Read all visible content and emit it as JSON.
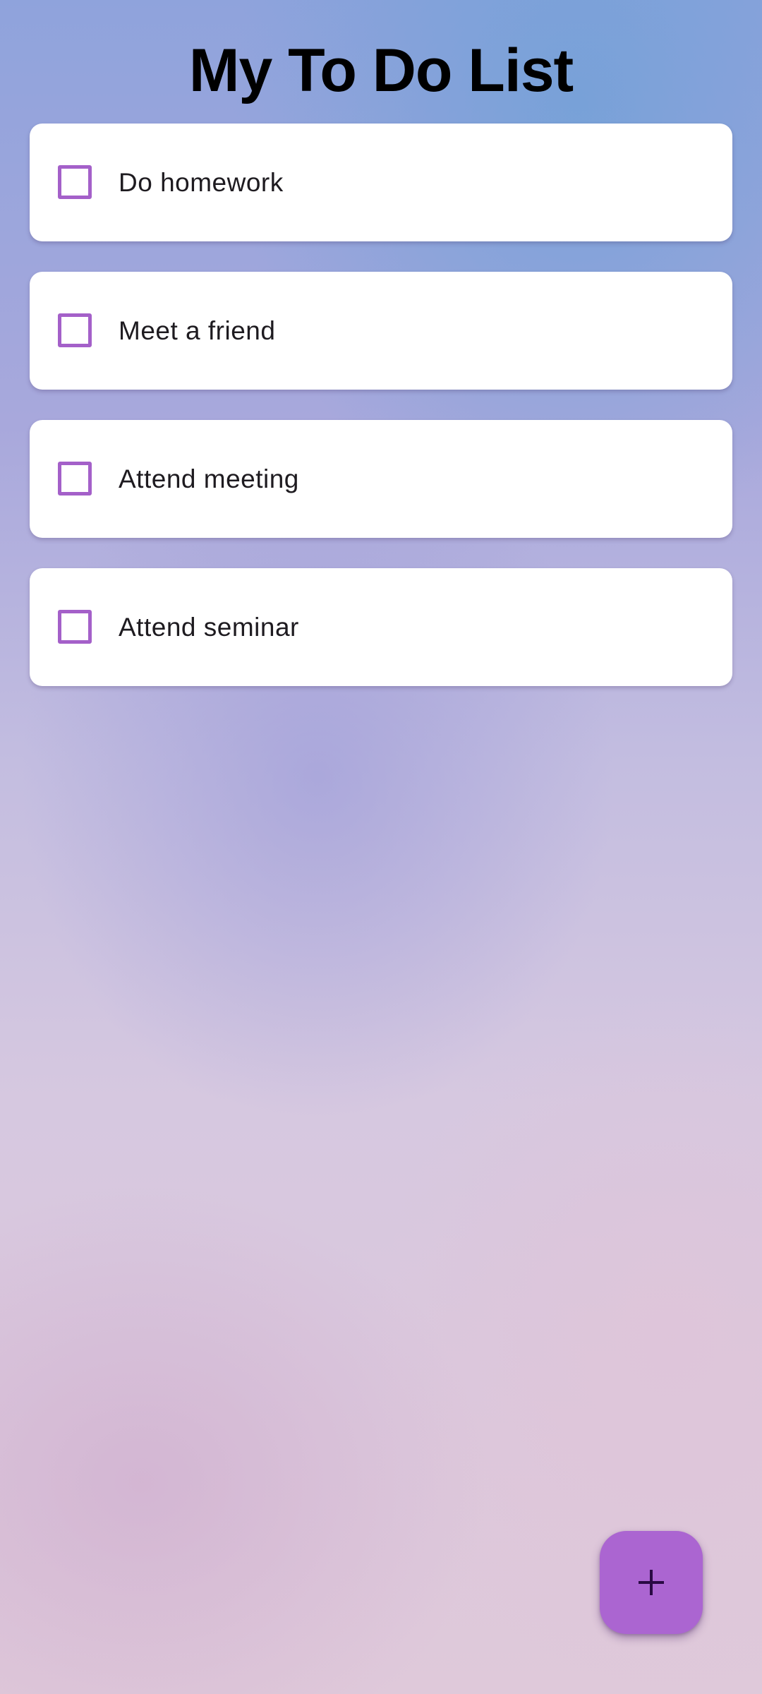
{
  "header": {
    "title": "My To Do List"
  },
  "tasks": [
    {
      "label": "Do homework",
      "checked": false
    },
    {
      "label": "Meet a friend",
      "checked": false
    },
    {
      "label": "Attend meeting",
      "checked": false
    },
    {
      "label": "Attend seminar",
      "checked": false
    }
  ],
  "fab": {
    "icon": "plus-icon"
  },
  "colors": {
    "accent": "#ab65d1",
    "checkbox_border": "#a460c9",
    "card_background": "#ffffff",
    "title_text": "#000000",
    "task_text": "#1e1b20"
  }
}
